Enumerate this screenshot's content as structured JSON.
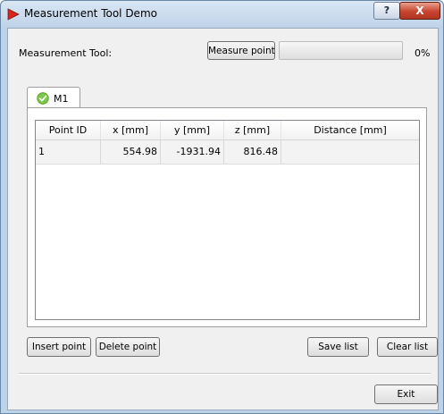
{
  "window": {
    "title": "Measurement Tool Demo",
    "help_label": "?",
    "close_label": "X"
  },
  "toolbar": {
    "label": "Measurement Tool:",
    "measure_button": "Measure point",
    "progress_percent": 0,
    "progress_text": "0%"
  },
  "tabs": [
    {
      "label": "M1",
      "icon": "checkmark-icon",
      "selected": true
    }
  ],
  "table": {
    "columns": [
      "Point ID",
      "x [mm]",
      "y [mm]",
      "z [mm]",
      "Distance  [mm]"
    ],
    "rows": [
      {
        "point_id": "1",
        "x": "554.98",
        "y": "-1931.94",
        "z": "816.48",
        "distance": ""
      }
    ]
  },
  "actions": {
    "insert": "Insert point",
    "delete": "Delete point",
    "save": "Save list",
    "clear": "Clear list"
  },
  "footer": {
    "exit": "Exit"
  },
  "colors": {
    "progress_fill": "#6cc24a",
    "tab_check": "#7ac943",
    "app_icon": "#d8261c",
    "close_button": "#c6442f"
  }
}
